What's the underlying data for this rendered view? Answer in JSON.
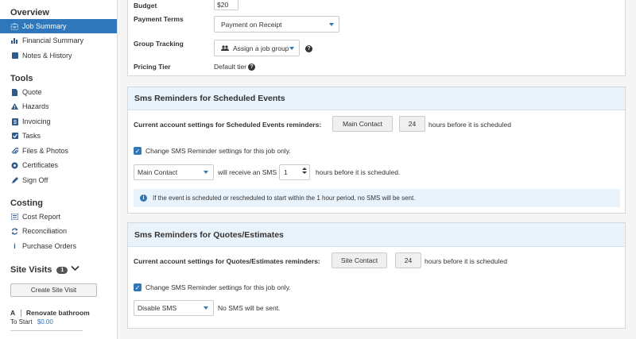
{
  "sidebar": {
    "overview": {
      "title": "Overview",
      "items": [
        {
          "label": "Job Summary",
          "icon": "briefcase-icon",
          "active": true
        },
        {
          "label": "Financial Summary",
          "icon": "bar-chart-icon"
        },
        {
          "label": "Notes & History",
          "icon": "notes-icon"
        }
      ]
    },
    "tools": {
      "title": "Tools",
      "items": [
        {
          "label": "Quote",
          "icon": "document-icon"
        },
        {
          "label": "Hazards",
          "icon": "warning-icon"
        },
        {
          "label": "Invoicing",
          "icon": "dollar-icon"
        },
        {
          "label": "Tasks",
          "icon": "checkbox-icon"
        },
        {
          "label": "Files & Photos",
          "icon": "paperclip-icon"
        },
        {
          "label": "Certificates",
          "icon": "certificate-icon"
        },
        {
          "label": "Sign Off",
          "icon": "pen-icon"
        }
      ]
    },
    "costing": {
      "title": "Costing",
      "items": [
        {
          "label": "Cost Report",
          "icon": "list-icon"
        },
        {
          "label": "Reconciliation",
          "icon": "refresh-icon"
        },
        {
          "label": "Purchase Orders",
          "icon": "info-icon"
        }
      ]
    },
    "site_visits": {
      "title": "Site Visits",
      "count": "1",
      "create_label": "Create Site Visit",
      "visit": {
        "code": "A",
        "title": "Renovate bathroom",
        "status": "To Start",
        "amount": "$0.00"
      }
    }
  },
  "job": {
    "budget_label": "Budget",
    "budget_value": "$20",
    "payment_terms_label": "Payment Terms",
    "payment_terms_value": "Payment on Receipt",
    "group_tracking_label": "Group Tracking",
    "group_tracking_button": "Assign a job group",
    "pricing_tier_label": "Pricing Tier",
    "pricing_tier_value": "Default tier"
  },
  "sms_events": {
    "title": "Sms Reminders for Scheduled Events",
    "account_label": "Current account settings for Scheduled Events reminders:",
    "account_contact": "Main Contact",
    "account_hours": "24",
    "account_suffix": "hours before it is scheduled",
    "change_label": "Change SMS Reminder settings for this job only.",
    "contact_select": "Main Contact",
    "receive_text": "will receive an SMS",
    "hours_value": "1",
    "hours_suffix": "hours before it is scheduled.",
    "info_text": "If the event is scheduled or rescheduled to start within the 1 hour period, no SMS will be sent."
  },
  "sms_quotes": {
    "title": "Sms Reminders for Quotes/Estimates",
    "account_label": "Current account settings for Quotes/Estimates reminders:",
    "account_contact": "Site Contact",
    "account_hours": "24",
    "account_suffix": "hours before it is scheduled",
    "change_label": "Change SMS Reminder settings for this job only.",
    "select_value": "Disable SMS",
    "no_sms_text": "No SMS will be sent."
  }
}
